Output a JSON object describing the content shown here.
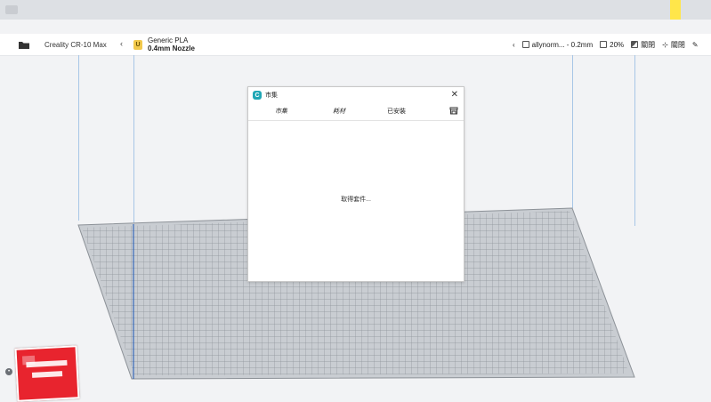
{
  "toolbar": {
    "printer_name": "Creality CR-10 Max",
    "material_name": "Generic PLA",
    "nozzle": "0.4mm Nozzle",
    "profile_name": "allynorm... - 0.2mm",
    "infill_percent": "20%",
    "support_state": "關閉",
    "adhesion_state": "關閉"
  },
  "dialog": {
    "title": "市集",
    "tabs": [
      "市集",
      "耗材",
      "已安裝"
    ],
    "loading_text": "取得套件..."
  },
  "colors": {
    "accent_teal": "#20a7b5",
    "material_badge": "#f2c94c",
    "sticker_red": "#e8242e",
    "build_volume_line": "#a8c6e6"
  },
  "icons": [
    "folder-icon",
    "chevron-left-icon",
    "material-badge-icon",
    "infill-icon",
    "support-icon",
    "adhesion-icon",
    "edit-icon",
    "close-icon",
    "store-icon",
    "cura-logo-icon"
  ]
}
